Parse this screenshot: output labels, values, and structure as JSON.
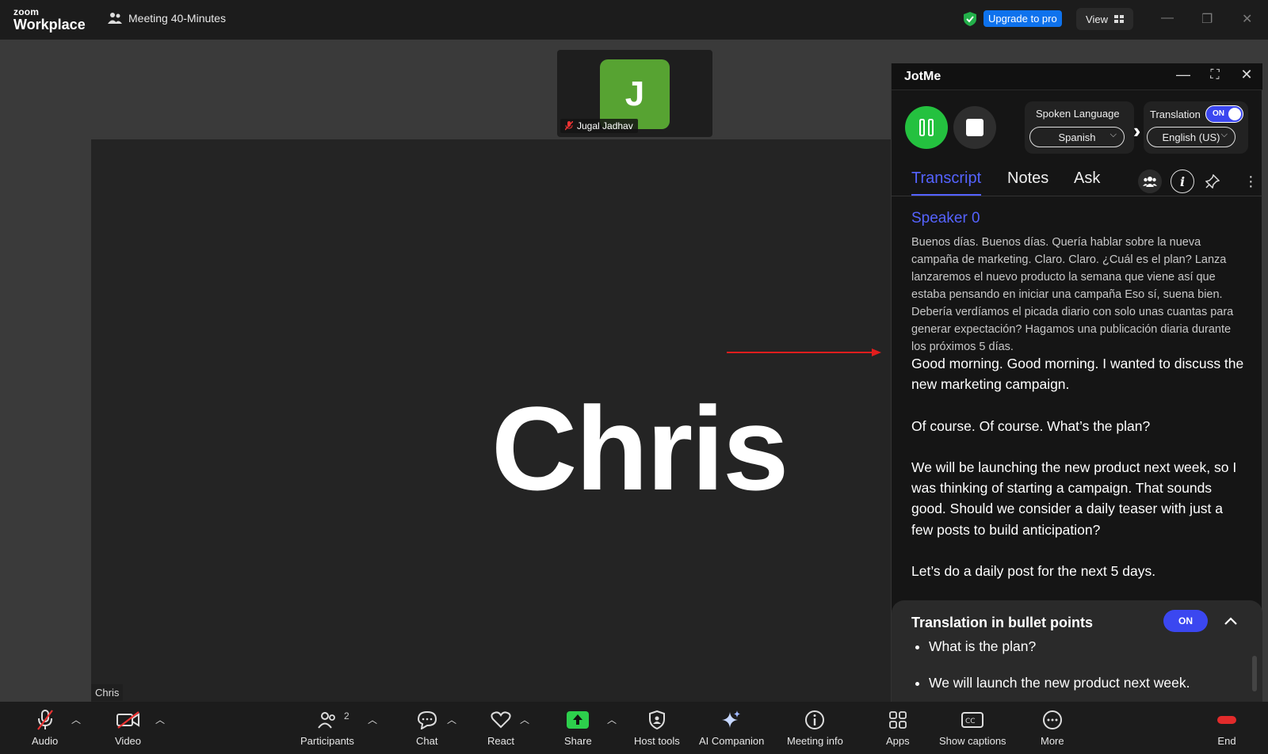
{
  "titlebar": {
    "brand_small": "zoom",
    "brand_large": "Workplace",
    "meeting_title": "Meeting 40-Minutes",
    "upgrade_label": "Upgrade to pro",
    "view_label": "View"
  },
  "stage": {
    "speaker_name": "Chris",
    "name_tag": "Chris",
    "thumbnail": {
      "initial": "J",
      "name": "Jugal Jadhav",
      "avatar_color": "#57a332"
    }
  },
  "jotme": {
    "title": "JotMe",
    "spoken_language_label": "Spoken Language",
    "spoken_language_value": "Spanish",
    "translation_label": "Translation",
    "translation_toggle": "ON",
    "target_language_value": "English (US)",
    "tabs": [
      "Transcript",
      "Notes",
      "Ask"
    ],
    "speaker": "Speaker 0",
    "original_text": "Buenos días. Buenos días. Quería hablar sobre la nueva campaña de marketing. Claro. Claro. ¿Cuál es el plan? Lanza lanzaremos el nuevo producto la semana que viene así que estaba pensando en iniciar una campaña Eso sí, suena bien. Debería verdíamos el picada diario con solo unas cuantas para generar expectación? Hagamos una publicación diaria durante los próximos 5 días.",
    "translated_paragraphs": [
      "Good morning. Good morning. I wanted to discuss the new marketing campaign.",
      "Of course. Of course. What’s the plan?",
      "We will be launching the new product next week, so I was thinking of starting a campaign. That sounds good. Should we consider a daily teaser with just a few posts to build anticipation?",
      "Let’s do a daily post for the next 5 days."
    ],
    "bullets_panel": {
      "title": "Translation in bullet points",
      "toggle": "ON",
      "items": [
        "What is the plan?",
        "We will launch the new product next week."
      ]
    },
    "accent_color": "#5563ff",
    "record_color": "#24c13f"
  },
  "toolbar": {
    "audio": "Audio",
    "video": "Video",
    "participants": "Participants",
    "participant_count": "2",
    "chat": "Chat",
    "react": "React",
    "share": "Share",
    "host_tools": "Host tools",
    "ai_companion": "AI Companion",
    "meeting_info": "Meeting info",
    "apps": "Apps",
    "show_captions": "Show captions",
    "more": "More",
    "end": "End"
  }
}
